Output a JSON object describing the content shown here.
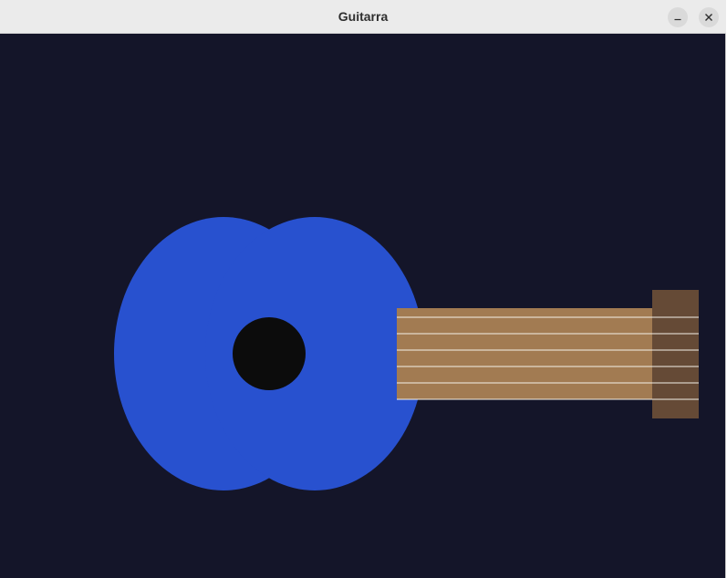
{
  "window": {
    "title": "Guitarra",
    "background_color": "#141529",
    "titlebar_color": "#ebebeb",
    "minimize_icon": "minimize-icon",
    "close_icon": "close-icon"
  },
  "guitar": {
    "body_color": "#2851cf",
    "soundhole_color": "#0c0c0c",
    "neck_color": "#a27b52",
    "headstock_color": "#654a36",
    "string_color": "#f4f0e8",
    "string_count": 6
  }
}
